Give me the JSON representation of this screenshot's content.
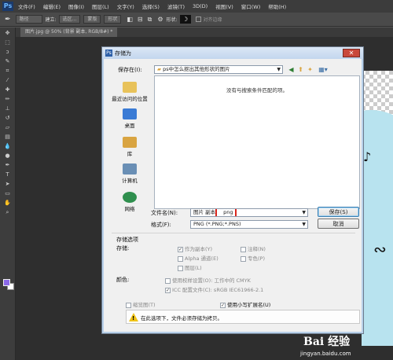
{
  "app": {
    "logo": "Ps",
    "menu": [
      "文件(F)",
      "编辑(E)",
      "图像(I)",
      "图层(L)",
      "文字(Y)",
      "选择(S)",
      "滤镜(T)",
      "3D(D)",
      "视图(V)",
      "窗口(W)",
      "帮助(H)"
    ],
    "options": {
      "mode_value": "路径",
      "build_label": "建立:",
      "select_btn": "选区...",
      "mask_btn": "蒙版",
      "shape_btn": "形状",
      "shape_label": "形状:",
      "align_label": "对齐边缘"
    },
    "doc_tab": "图片.jpg @ 50% (背景 副本, RGB/8#) *"
  },
  "dialog": {
    "title": "存储为",
    "save_in_label": "保存在(I):",
    "save_in_value": "ps中怎么抠出其他形状的图片",
    "empty_message": "没有与搜索条件匹配的项。",
    "places": [
      {
        "label": "最近访问的位置",
        "icon": "recent-places-icon",
        "color": "#e8c25a"
      },
      {
        "label": "桌面",
        "icon": "desktop-icon",
        "color": "#3a7bd5"
      },
      {
        "label": "库",
        "icon": "library-icon",
        "color": "#d9a441"
      },
      {
        "label": "计算机",
        "icon": "computer-icon",
        "color": "#6a8fb5"
      },
      {
        "label": "网络",
        "icon": "network-icon",
        "color": "#2f8f4e"
      }
    ],
    "filename_label": "文件名(N):",
    "filename_value": "图片 副本",
    "filename_ext": "png",
    "format_label": "格式(F):",
    "format_value": "PNG (*.PNG;*.PNS)",
    "save_button": "保存(S)",
    "cancel_button": "取消",
    "options_header": "存储选项",
    "storage_label": "存储:",
    "as_copy": "作为副本(Y)",
    "notes": "注释(N)",
    "alpha": "Alpha 通道(E)",
    "spot": "专色(P)",
    "layers": "图层(L)",
    "color_label": "颜色:",
    "proof": "使用校样设置(O): 工作中的 CMYK",
    "icc": "ICC 配置文件(C): sRGB IEC61966-2.1",
    "thumbnail": "缩览图(T)",
    "lowercase_ext": "使用小写扩展名(U)",
    "warning": "在此选项下，文件必须存储为拷贝。"
  },
  "watermark": {
    "main": "Bai 经验",
    "sub": "jingyan.baidu.com"
  }
}
